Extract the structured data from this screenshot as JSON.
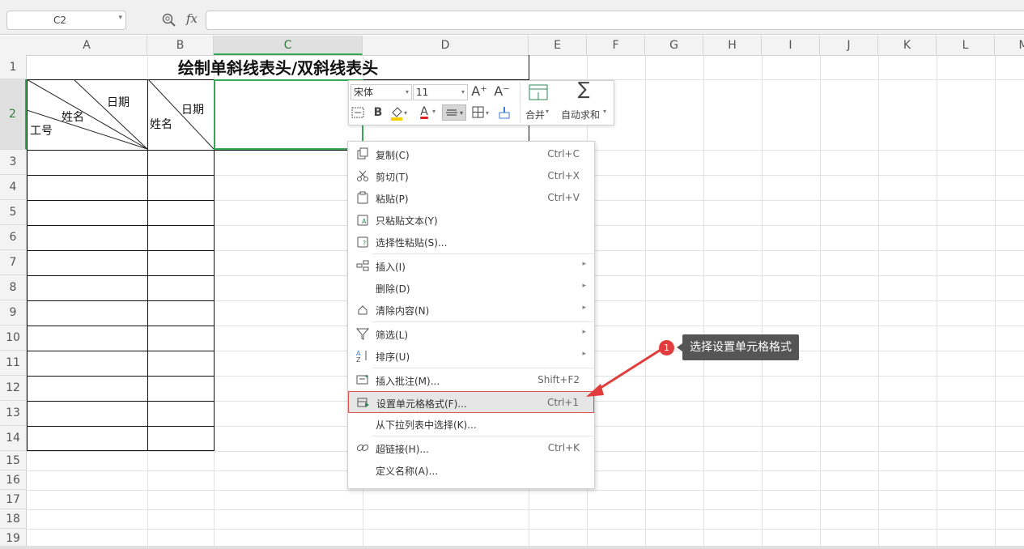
{
  "formula_bar": {
    "name_box": "C2",
    "fx_label": "fx",
    "formula": ""
  },
  "columns": [
    "A",
    "B",
    "C",
    "D",
    "E",
    "F",
    "G",
    "H",
    "I",
    "J",
    "K",
    "L",
    "M"
  ],
  "selected_column": "C",
  "rows": [
    "1",
    "2",
    "3",
    "4",
    "5",
    "6",
    "7",
    "8",
    "9",
    "10",
    "11",
    "12",
    "13",
    "14",
    "15",
    "16",
    "17",
    "18",
    "19"
  ],
  "selected_row": "2",
  "sheet": {
    "title": "绘制单斜线表头/双斜线表头",
    "a2": {
      "date": "日期",
      "name": "姓名",
      "id": "工号"
    },
    "b2": {
      "date": "日期",
      "name": "姓名"
    }
  },
  "mini_toolbar": {
    "font_name": "宋体",
    "font_size": "11",
    "grow_font": "A⁺",
    "shrink_font": "A⁻",
    "merge_label": "合并",
    "autosum_label": "自动求和",
    "bold": "B",
    "font_color_letter": "A",
    "font_color": "#e02020",
    "fill_color": "#f5d000"
  },
  "context_menu": [
    {
      "label": "复制(C)",
      "shortcut": "Ctrl+C",
      "icon": "copy-icon"
    },
    {
      "label": "剪切(T)",
      "shortcut": "Ctrl+X",
      "icon": "scissors-icon"
    },
    {
      "label": "粘贴(P)",
      "shortcut": "Ctrl+V",
      "icon": "paste-icon"
    },
    {
      "label": "只粘贴文本(Y)",
      "shortcut": "",
      "icon": "paste-text-icon"
    },
    {
      "label": "选择性粘贴(S)...",
      "shortcut": "",
      "icon": "paste-special-icon"
    },
    {
      "label": "插入(I)",
      "shortcut": "",
      "icon": "insert-icon",
      "submenu": true
    },
    {
      "label": "删除(D)",
      "shortcut": "",
      "icon": "",
      "submenu": true
    },
    {
      "label": "清除内容(N)",
      "shortcut": "",
      "icon": "eraser-icon",
      "submenu": true
    },
    {
      "label": "筛选(L)",
      "shortcut": "",
      "icon": "filter-icon",
      "submenu": true
    },
    {
      "label": "排序(U)",
      "shortcut": "",
      "icon": "sort-icon",
      "submenu": true
    },
    {
      "label": "插入批注(M)...",
      "shortcut": "Shift+F2",
      "icon": "comment-icon"
    },
    {
      "label": "设置单元格格式(F)...",
      "shortcut": "Ctrl+1",
      "icon": "format-cells-icon",
      "highlighted": true
    },
    {
      "label": "从下拉列表中选择(K)...",
      "shortcut": "",
      "icon": ""
    },
    {
      "label": "超链接(H)...",
      "shortcut": "Ctrl+K",
      "icon": "link-icon"
    },
    {
      "label": "定义名称(A)...",
      "shortcut": "",
      "icon": ""
    }
  ],
  "annotation": {
    "step": "1",
    "text": "选择设置单元格格式",
    "color": "#e23d3d"
  }
}
